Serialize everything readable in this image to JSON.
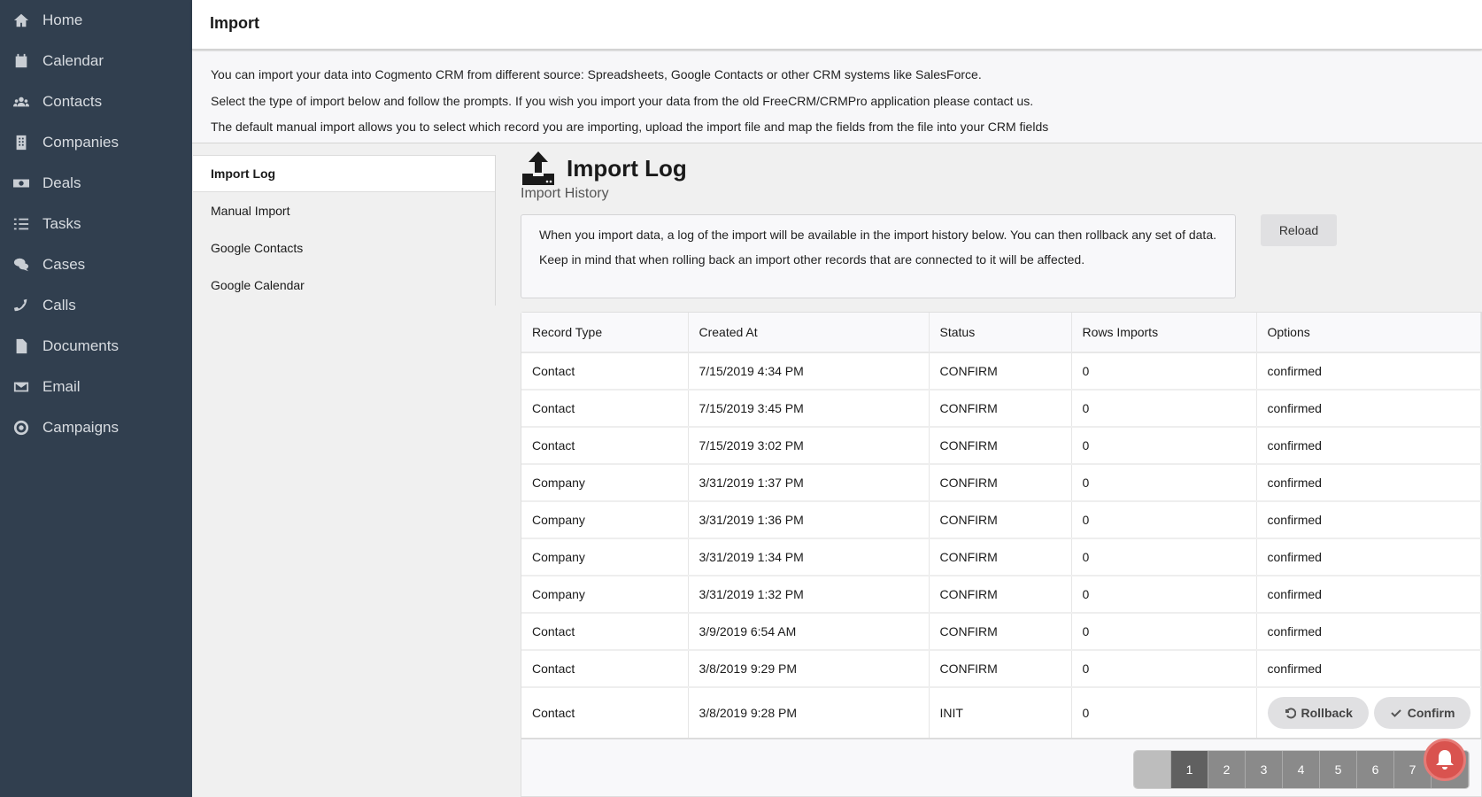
{
  "sidebar": {
    "items": [
      {
        "label": "Home",
        "icon": "home-icon"
      },
      {
        "label": "Calendar",
        "icon": "calendar-icon"
      },
      {
        "label": "Contacts",
        "icon": "users-icon"
      },
      {
        "label": "Companies",
        "icon": "building-icon"
      },
      {
        "label": "Deals",
        "icon": "money-icon"
      },
      {
        "label": "Tasks",
        "icon": "tasks-icon"
      },
      {
        "label": "Cases",
        "icon": "comments-icon"
      },
      {
        "label": "Calls",
        "icon": "phone-icon"
      },
      {
        "label": "Documents",
        "icon": "file-icon"
      },
      {
        "label": "Email",
        "icon": "envelope-icon"
      },
      {
        "label": "Campaigns",
        "icon": "target-icon"
      }
    ]
  },
  "header": {
    "title": "Import"
  },
  "intro": {
    "lines": [
      "You can import your data into Cogmento CRM from different source: Spreadsheets, Google Contacts or other CRM systems like SalesForce.",
      "Select the type of import below and follow the prompts. If you wish you import your data from the old FreeCRM/CRMPro application please contact us.",
      "The default manual import allows you to select which record you are importing, upload the import file and map the fields from the file into your CRM fields"
    ]
  },
  "tabs": [
    {
      "label": "Import Log",
      "active": true
    },
    {
      "label": "Manual Import"
    },
    {
      "label": "Google Contacts"
    },
    {
      "label": "Google Calendar"
    }
  ],
  "panel": {
    "title": "Import Log",
    "subtitle": "Import History",
    "info": [
      "When you import data, a log of the import will be available in the import history below. You can then rollback any set of data.",
      "Keep in mind that when rolling back an import other records that are connected to it will be affected."
    ],
    "reload_label": "Reload"
  },
  "table": {
    "columns": [
      "Record Type",
      "Created At",
      "Status",
      "Rows Imports",
      "Options"
    ],
    "rows": [
      [
        "Contact",
        "7/15/2019 4:34 PM",
        "CONFIRM",
        "0",
        "confirmed"
      ],
      [
        "Contact",
        "7/15/2019 3:45 PM",
        "CONFIRM",
        "0",
        "confirmed"
      ],
      [
        "Contact",
        "7/15/2019 3:02 PM",
        "CONFIRM",
        "0",
        "confirmed"
      ],
      [
        "Company",
        "3/31/2019 1:37 PM",
        "CONFIRM",
        "0",
        "confirmed"
      ],
      [
        "Company",
        "3/31/2019 1:36 PM",
        "CONFIRM",
        "0",
        "confirmed"
      ],
      [
        "Company",
        "3/31/2019 1:34 PM",
        "CONFIRM",
        "0",
        "confirmed"
      ],
      [
        "Company",
        "3/31/2019 1:32 PM",
        "CONFIRM",
        "0",
        "confirmed"
      ],
      [
        "Contact",
        "3/9/2019 6:54 AM",
        "CONFIRM",
        "0",
        "confirmed"
      ],
      [
        "Contact",
        "3/8/2019 9:29 PM",
        "CONFIRM",
        "0",
        "confirmed"
      ]
    ],
    "last_row": [
      "Contact",
      "3/8/2019 9:28 PM",
      "INIT",
      "0"
    ],
    "rollback_label": "Rollback",
    "confirm_label": "Confirm"
  },
  "pagination": {
    "prev_label": "‹",
    "pages": [
      "1",
      "2",
      "3",
      "4",
      "5",
      "6",
      "7"
    ],
    "current": "1"
  },
  "colors": {
    "sidebar_bg": "#313f4f",
    "notification": "#d9534f"
  }
}
